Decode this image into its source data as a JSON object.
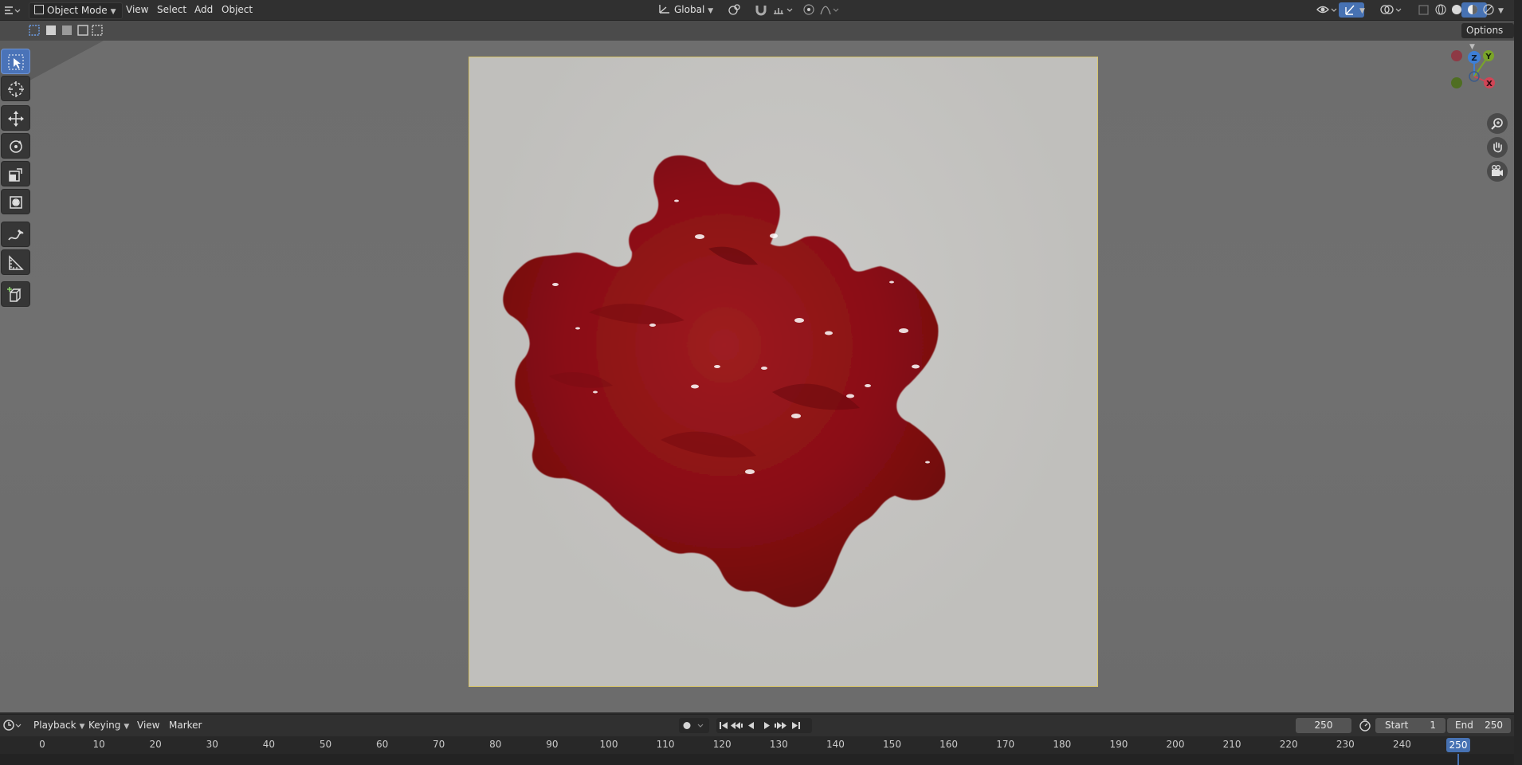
{
  "header": {
    "mode": "Object Mode",
    "menus": [
      "View",
      "Select",
      "Add",
      "Object"
    ],
    "orientation": "Global",
    "options_label": "Options"
  },
  "toolbar": {
    "tools": [
      "select-box",
      "cursor",
      "move",
      "rotate",
      "scale",
      "transform",
      "annotate",
      "measure",
      "add-cube"
    ],
    "active_tool": "select-box"
  },
  "navigation_gizmo": {
    "axes": [
      "Y",
      "Z",
      "X"
    ],
    "colors": {
      "x": "#d04556",
      "y": "#7aa429",
      "z": "#3e7fd6"
    }
  },
  "viewport": {
    "background": "#6e6e6e",
    "camera_frame_color": "#c6c5c2",
    "object_color": "#8a0f14"
  },
  "timeline": {
    "menus": [
      "Playback",
      "Keying",
      "View",
      "Marker"
    ],
    "current_frame": "250",
    "start_label": "Start",
    "start_value": "1",
    "end_label": "End",
    "end_value": "250",
    "ruler_ticks": [
      "0",
      "10",
      "20",
      "30",
      "40",
      "50",
      "60",
      "70",
      "80",
      "90",
      "100",
      "110",
      "120",
      "130",
      "140",
      "150",
      "160",
      "170",
      "180",
      "190",
      "200",
      "210",
      "220",
      "230",
      "240"
    ],
    "playhead": "250",
    "accent": "#4772b3"
  }
}
